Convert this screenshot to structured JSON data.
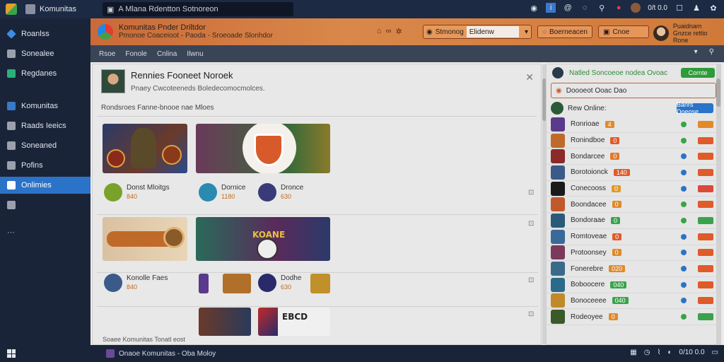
{
  "titlebar": {
    "title": "Komunitas",
    "search_text": "A Mlana Rdentton Sotnoreon",
    "time": "0/t 0.0"
  },
  "sidebar": {
    "items": [
      {
        "label": "Roanlss",
        "icon": "diamond-icon",
        "color": "#3a8ee6"
      },
      {
        "label": "Sonealee",
        "icon": "speaker-icon",
        "color": "#9aa1ad"
      },
      {
        "label": "Regdanes",
        "icon": "chat-icon",
        "color": "#2bb07a"
      },
      {
        "label": "Komunitas",
        "icon": "people-icon",
        "color": "#3a78c8"
      },
      {
        "label": "Raads Ieeics",
        "icon": "gamepad-icon",
        "color": "#9aa1ad"
      },
      {
        "label": "Soneaned",
        "icon": "store-icon",
        "color": "#9aa1ad"
      },
      {
        "label": "Pofins",
        "icon": "puzzle-icon",
        "color": "#9aa1ad"
      },
      {
        "label": "Onlimies",
        "icon": "online-icon",
        "color": "#ffffff",
        "active": true
      },
      {
        "label": "",
        "icon": "home-icon",
        "color": "#9aa1ad"
      }
    ]
  },
  "header": {
    "title": "Komunitas Pnder Driltdor",
    "subtitle": "Pmonoe Coaceioot - Paoda - Sroeoade Slonhdor",
    "dropdown_value": "Stmonog",
    "dropdown_inner": "Elidenw",
    "button1": "Boerneacen",
    "button2": "Cnoe",
    "user_name": "Puaidnam",
    "user_status": "Gnzce rettio Rone"
  },
  "subbar": {
    "tabs": [
      "Rsoe",
      "Fonole",
      "Cnlina",
      "Ilwnu"
    ]
  },
  "panel": {
    "title": "Rennies Fooneet Noroek",
    "subtitle": "Pnaey Cwcoteeneds Boledecomocmolces.",
    "section": "Rondsroes Fanne-bnooe nae Mloes",
    "row1_meta": [
      {
        "name": "Donst Mloitgs",
        "num": "840"
      },
      {
        "name": "Dornice",
        "num": "1180"
      },
      {
        "name": "Dronce",
        "num": "630"
      }
    ],
    "row2_meta": [
      {
        "name": "Konolle Faes",
        "num": "840"
      },
      {
        "name": "Dodhe",
        "num": "630"
      }
    ],
    "row3_meta": [
      {
        "name": "",
        "num": ""
      }
    ],
    "banner_text": "KOANE",
    "tile_text": "EBCD",
    "footer": "Soaee Komunitas Tonatl eost"
  },
  "right_panel": {
    "header": "Natled Soncoeoe nodea Ovoac",
    "header_btn": "Cornte",
    "search": "Doooeot Ooac Dao",
    "online_label": "Rew Online:",
    "online_btn": "Banrs Doeose",
    "friends": [
      {
        "name": "Ronrioae",
        "badge": "4",
        "bcolor": "#e08a2a",
        "status": "#3aa34a",
        "tag": "#e08a2a"
      },
      {
        "name": "Ronindboe",
        "badge": "0",
        "bcolor": "#e05a2a",
        "status": "#3aa34a",
        "tag": "#e05a2a"
      },
      {
        "name": "Bondarcee",
        "badge": "0",
        "bcolor": "#e07a2a",
        "status": "#2b73c8",
        "tag": "#e05a2a"
      },
      {
        "name": "Borotoionck",
        "badge": "140",
        "bcolor": "#e05a2a",
        "status": "#2b73c8",
        "tag": "#e05a2a"
      },
      {
        "name": "Conecooss",
        "badge": "0",
        "bcolor": "#e09a2a",
        "status": "#2b73c8",
        "tag": "#d94a3a"
      },
      {
        "name": "Boondacee",
        "badge": "0",
        "bcolor": "#e08a2a",
        "status": "#3aa34a",
        "tag": "#e05a2a"
      },
      {
        "name": "Bondoraae",
        "badge": "0",
        "bcolor": "#3aa34a",
        "status": "#3aa34a",
        "tag": "#3aa34a"
      },
      {
        "name": "Romtoveae",
        "badge": "0",
        "bcolor": "#e05a2a",
        "status": "#2b73c8",
        "tag": "#e05a2a"
      },
      {
        "name": "Protoonsey",
        "badge": "0",
        "bcolor": "#e08a2a",
        "status": "#2b73c8",
        "tag": "#e05a2a"
      },
      {
        "name": "Fonerebre",
        "badge": "020",
        "bcolor": "#e08a2a",
        "status": "#2b73c8",
        "tag": "#e05a2a"
      },
      {
        "name": "Boboocere",
        "badge": "040",
        "bcolor": "#3aa34a",
        "status": "#2b73c8",
        "tag": "#e05a2a"
      },
      {
        "name": "Bonoceeee",
        "badge": "040",
        "bcolor": "#3aa34a",
        "status": "#2b73c8",
        "tag": "#e05a2a"
      },
      {
        "name": "Rodeoyee",
        "badge": "0",
        "bcolor": "#e08a2a",
        "status": "#3aa34a",
        "tag": "#3aa34a"
      }
    ]
  },
  "taskbar": {
    "app": "Onaoe Komunitas - Oba Moloy",
    "clock": "0/10 0.0"
  }
}
